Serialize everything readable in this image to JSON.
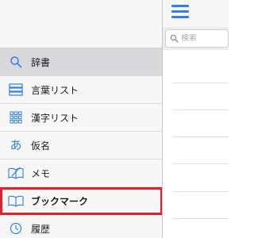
{
  "menu": {
    "items": [
      {
        "label": "辞書",
        "icon": "search-icon",
        "selected": true
      },
      {
        "label": "言葉リスト",
        "icon": "word-list-icon"
      },
      {
        "label": "漢字リスト",
        "icon": "kanji-grid-icon"
      },
      {
        "label": "仮名",
        "icon": "kana-icon",
        "glyph": "あ"
      },
      {
        "label": "メモ",
        "icon": "memo-icon"
      },
      {
        "label": "ブックマーク",
        "icon": "bookmark-book-icon",
        "highlighted": true
      },
      {
        "label": "履歴",
        "icon": "history-clock-icon"
      }
    ]
  },
  "search": {
    "placeholder": "検索"
  },
  "colors": {
    "accent": "#2f7ff0",
    "highlight_border": "#e0232b",
    "selected_bg": "#d9d9dc"
  }
}
